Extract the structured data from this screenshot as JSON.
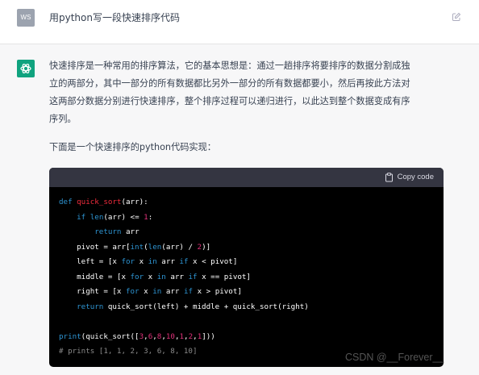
{
  "user": {
    "avatar_text": "WS",
    "message": "用python写一段快速排序代码",
    "edit_icon": "edit-icon"
  },
  "assistant": {
    "avatar_icon": "openai-logo-icon",
    "paragraph_lines": [
      "快速排序是一种常用的排序算法，它的基本思想是：通过一趟排序将要排序的数据分割成独",
      "立的两部分，其中一部分的所有数据都比另外一部分的所有数据都要小，然后再按此方法对",
      "这两部分数据分别进行快速排序，整个排序过程可以递归进行，以此达到整个数据变成有序",
      "序列。"
    ],
    "intro": "下面是一个快速排序的python代码实现：",
    "code": {
      "copy_label": "Copy code",
      "copy_icon": "clipboard-icon",
      "lines": [
        [
          {
            "t": "def ",
            "c": "kw"
          },
          {
            "t": "quick_sort",
            "c": "fn"
          },
          {
            "t": "(arr):",
            "c": ""
          }
        ],
        [
          {
            "t": "    ",
            "c": ""
          },
          {
            "t": "if ",
            "c": "kw"
          },
          {
            "t": "len",
            "c": "kw"
          },
          {
            "t": "(arr) <= ",
            "c": ""
          },
          {
            "t": "1",
            "c": "num"
          },
          {
            "t": ":",
            "c": ""
          }
        ],
        [
          {
            "t": "        ",
            "c": ""
          },
          {
            "t": "return ",
            "c": "kw"
          },
          {
            "t": "arr",
            "c": ""
          }
        ],
        [
          {
            "t": "    pivot = arr[",
            "c": ""
          },
          {
            "t": "int",
            "c": "kw"
          },
          {
            "t": "(",
            "c": ""
          },
          {
            "t": "len",
            "c": "kw"
          },
          {
            "t": "(arr) / ",
            "c": ""
          },
          {
            "t": "2",
            "c": "num"
          },
          {
            "t": ")]",
            "c": ""
          }
        ],
        [
          {
            "t": "    left = [x ",
            "c": ""
          },
          {
            "t": "for ",
            "c": "kw"
          },
          {
            "t": "x ",
            "c": ""
          },
          {
            "t": "in ",
            "c": "kw"
          },
          {
            "t": "arr ",
            "c": ""
          },
          {
            "t": "if ",
            "c": "kw"
          },
          {
            "t": "x < pivot]",
            "c": ""
          }
        ],
        [
          {
            "t": "    middle = [x ",
            "c": ""
          },
          {
            "t": "for ",
            "c": "kw"
          },
          {
            "t": "x ",
            "c": ""
          },
          {
            "t": "in ",
            "c": "kw"
          },
          {
            "t": "arr ",
            "c": ""
          },
          {
            "t": "if ",
            "c": "kw"
          },
          {
            "t": "x == pivot]",
            "c": ""
          }
        ],
        [
          {
            "t": "    right = [x ",
            "c": ""
          },
          {
            "t": "for ",
            "c": "kw"
          },
          {
            "t": "x ",
            "c": ""
          },
          {
            "t": "in ",
            "c": "kw"
          },
          {
            "t": "arr ",
            "c": ""
          },
          {
            "t": "if ",
            "c": "kw"
          },
          {
            "t": "x > pivot]",
            "c": ""
          }
        ],
        [
          {
            "t": "    ",
            "c": ""
          },
          {
            "t": "return ",
            "c": "kw"
          },
          {
            "t": "quick_sort(left) + middle + quick_sort(right)",
            "c": ""
          }
        ],
        [
          {
            "t": "",
            "c": ""
          }
        ],
        [
          {
            "t": "print",
            "c": "kw"
          },
          {
            "t": "(quick_sort([",
            "c": ""
          },
          {
            "t": "3",
            "c": "num"
          },
          {
            "t": ",",
            "c": ""
          },
          {
            "t": "6",
            "c": "num"
          },
          {
            "t": ",",
            "c": ""
          },
          {
            "t": "8",
            "c": "num"
          },
          {
            "t": ",",
            "c": ""
          },
          {
            "t": "10",
            "c": "num"
          },
          {
            "t": ",",
            "c": ""
          },
          {
            "t": "1",
            "c": "num"
          },
          {
            "t": ",",
            "c": ""
          },
          {
            "t": "2",
            "c": "num"
          },
          {
            "t": ",",
            "c": ""
          },
          {
            "t": "1",
            "c": "num"
          },
          {
            "t": "]))",
            "c": ""
          }
        ],
        [
          {
            "t": "# prints [1, 1, 2, 3, 6, 8, 10]",
            "c": "cm"
          }
        ]
      ]
    }
  },
  "watermark": "CSDN @__Forever__"
}
